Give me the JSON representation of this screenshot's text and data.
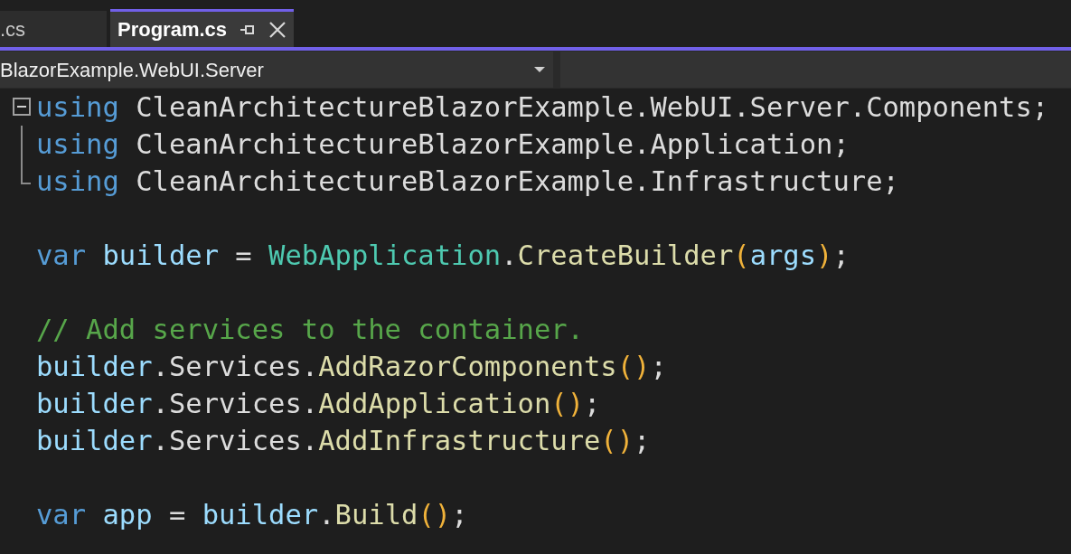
{
  "tabs": [
    {
      "label": ".cs",
      "selected": false
    },
    {
      "label": "Program.cs",
      "selected": true,
      "pinned": true
    }
  ],
  "project_dropdown": {
    "value": "BlazorExample.WebUI.Server"
  },
  "lines": [
    {
      "kind": "code",
      "fold": {
        "expanded": true
      },
      "tokens": [
        {
          "text": "using",
          "kind": "keyword"
        },
        {
          "text": " CleanArchitectureBlazorExample.WebUI.Server.Components;",
          "kind": "plain"
        }
      ]
    },
    {
      "kind": "code",
      "in_fold": true,
      "fold_end": false,
      "tokens": [
        {
          "text": "using",
          "kind": "keyword"
        },
        {
          "text": " CleanArchitectureBlazorExample.Application;",
          "kind": "plain"
        }
      ]
    },
    {
      "kind": "code",
      "in_fold": true,
      "fold_end": true,
      "tokens": [
        {
          "text": "using",
          "kind": "keyword"
        },
        {
          "text": " CleanArchitectureBlazorExample.Infrastructure;",
          "kind": "plain"
        }
      ]
    },
    {
      "kind": "blank"
    },
    {
      "kind": "code",
      "tokens": [
        {
          "text": "var ",
          "kind": "keyword"
        },
        {
          "text": "builder",
          "kind": "variable"
        },
        {
          "text": " = ",
          "kind": "plain"
        },
        {
          "text": "WebApplication",
          "kind": "type"
        },
        {
          "text": ".",
          "kind": "plain"
        },
        {
          "text": "CreateBuilder",
          "kind": "method"
        },
        {
          "text": "(",
          "kind": "paren"
        },
        {
          "text": "args",
          "kind": "variable"
        },
        {
          "text": ")",
          "kind": "paren"
        },
        {
          "text": ";",
          "kind": "plain"
        }
      ]
    },
    {
      "kind": "blank"
    },
    {
      "kind": "code",
      "tokens": [
        {
          "text": "// Add services to the container.",
          "kind": "comment"
        }
      ]
    },
    {
      "kind": "code",
      "tokens": [
        {
          "text": "builder",
          "kind": "variable"
        },
        {
          "text": ".Services.",
          "kind": "plain"
        },
        {
          "text": "AddRazorComponents",
          "kind": "method"
        },
        {
          "text": "()",
          "kind": "paren"
        },
        {
          "text": ";",
          "kind": "plain"
        }
      ]
    },
    {
      "kind": "code",
      "tokens": [
        {
          "text": "builder",
          "kind": "variable"
        },
        {
          "text": ".Services.",
          "kind": "plain"
        },
        {
          "text": "AddApplication",
          "kind": "method"
        },
        {
          "text": "()",
          "kind": "paren"
        },
        {
          "text": ";",
          "kind": "plain"
        }
      ]
    },
    {
      "kind": "code",
      "tokens": [
        {
          "text": "builder",
          "kind": "variable"
        },
        {
          "text": ".Services.",
          "kind": "plain"
        },
        {
          "text": "AddInfrastructure",
          "kind": "method"
        },
        {
          "text": "()",
          "kind": "paren"
        },
        {
          "text": ";",
          "kind": "plain"
        }
      ]
    },
    {
      "kind": "blank"
    },
    {
      "kind": "code",
      "tokens": [
        {
          "text": "var ",
          "kind": "keyword"
        },
        {
          "text": "app",
          "kind": "variable"
        },
        {
          "text": " = ",
          "kind": "plain"
        },
        {
          "text": "builder",
          "kind": "variable"
        },
        {
          "text": ".",
          "kind": "plain"
        },
        {
          "text": "Build",
          "kind": "method"
        },
        {
          "text": "()",
          "kind": "paren"
        },
        {
          "text": ";",
          "kind": "plain"
        }
      ]
    }
  ]
}
